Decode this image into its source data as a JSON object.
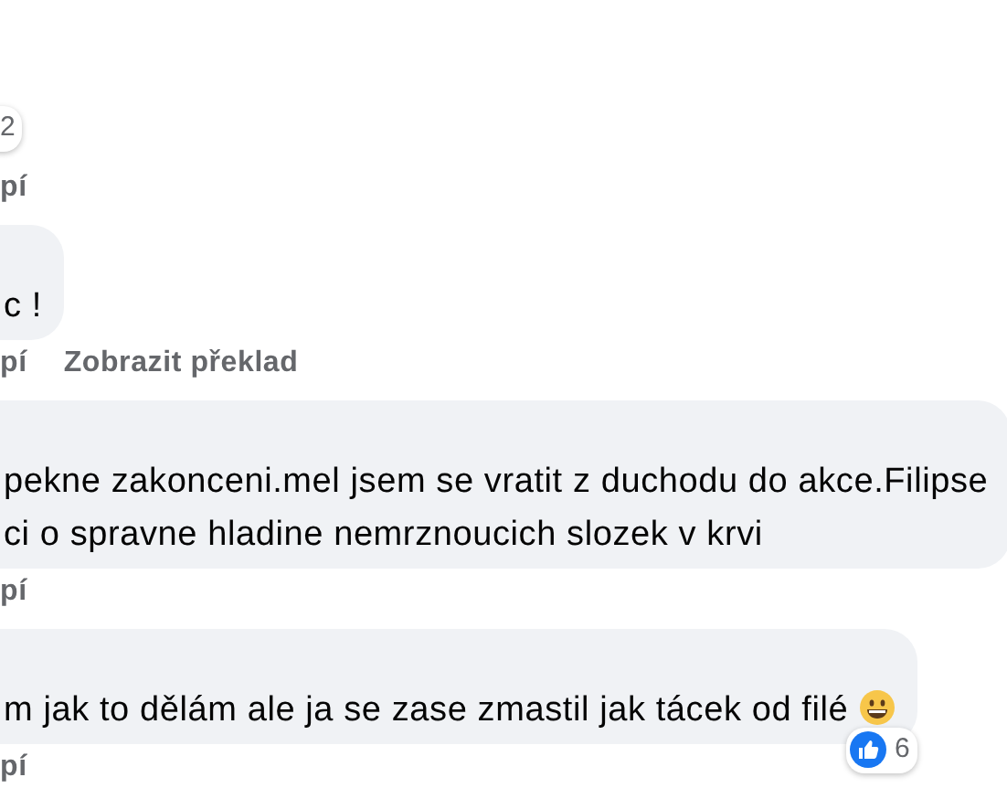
{
  "comments": [
    {
      "reaction_count": "2",
      "actions": [
        "pí"
      ]
    },
    {
      "lines": [
        "c !"
      ],
      "actions": [
        "pí",
        "Zobrazit překlad"
      ]
    },
    {
      "lines": [
        "pekne zakonceni.mel jsem se vratit z duchodu do akce.Filipse",
        "ci o spravne hladine nemrznoucich slozek v krvi"
      ],
      "actions": [
        "pí"
      ]
    },
    {
      "lines": [
        "m jak to dělám ale ja se zase zmastil jak tácek od filé"
      ],
      "ends_with_emoji": true,
      "reaction_count": "6",
      "actions": [
        "pí"
      ]
    }
  ]
}
